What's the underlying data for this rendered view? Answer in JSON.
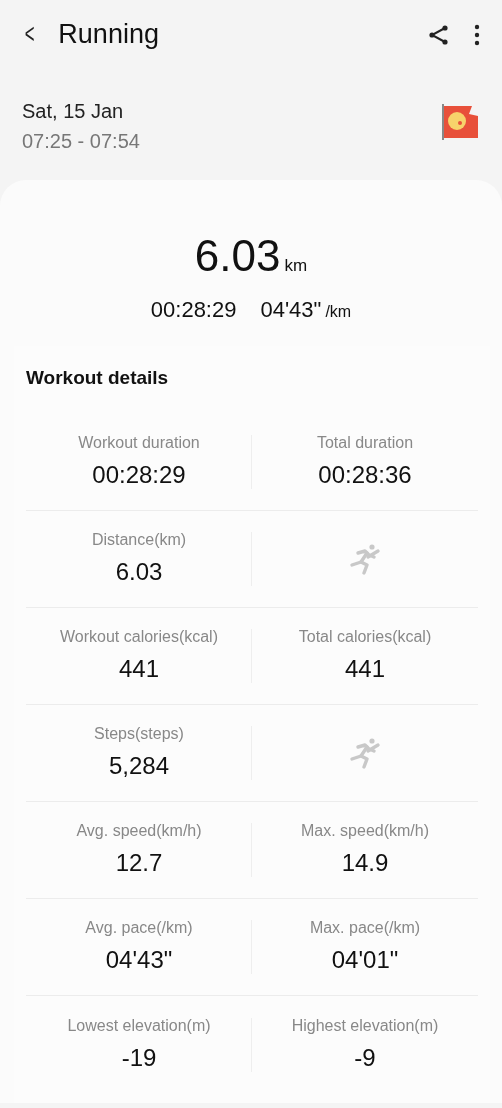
{
  "header": {
    "back": "<",
    "title": "Running"
  },
  "session": {
    "date": "Sat, 15 Jan",
    "time_range": "07:25 - 07:54"
  },
  "summary": {
    "distance": "6.03",
    "distance_unit": "km",
    "duration": "00:28:29",
    "pace": "04'43\"",
    "pace_unit": "/km"
  },
  "details": {
    "title": "Workout details",
    "rows": [
      {
        "cells": [
          {
            "kind": "stat",
            "label": "Workout duration",
            "value": "00:28:29"
          },
          {
            "kind": "stat",
            "label": "Total duration",
            "value": "00:28:36"
          }
        ]
      },
      {
        "cells": [
          {
            "kind": "stat",
            "label": "Distance(km)",
            "value": "6.03"
          },
          {
            "kind": "icon"
          }
        ]
      },
      {
        "cells": [
          {
            "kind": "stat",
            "label": "Workout calories(kcal)",
            "value": "441"
          },
          {
            "kind": "stat",
            "label": "Total calories(kcal)",
            "value": "441"
          }
        ]
      },
      {
        "cells": [
          {
            "kind": "stat",
            "label": "Steps(steps)",
            "value": "5,284"
          },
          {
            "kind": "icon"
          }
        ]
      },
      {
        "cells": [
          {
            "kind": "stat",
            "label": "Avg. speed(km/h)",
            "value": "12.7"
          },
          {
            "kind": "stat",
            "label": "Max. speed(km/h)",
            "value": "14.9"
          }
        ]
      },
      {
        "cells": [
          {
            "kind": "stat",
            "label": "Avg. pace(/km)",
            "value": "04'43\""
          },
          {
            "kind": "stat",
            "label": "Max. pace(/km)",
            "value": "04'01\""
          }
        ]
      },
      {
        "cells": [
          {
            "kind": "stat",
            "label": "Lowest elevation(m)",
            "value": "-19"
          },
          {
            "kind": "stat",
            "label": "Highest elevation(m)",
            "value": "-9"
          }
        ]
      }
    ]
  }
}
